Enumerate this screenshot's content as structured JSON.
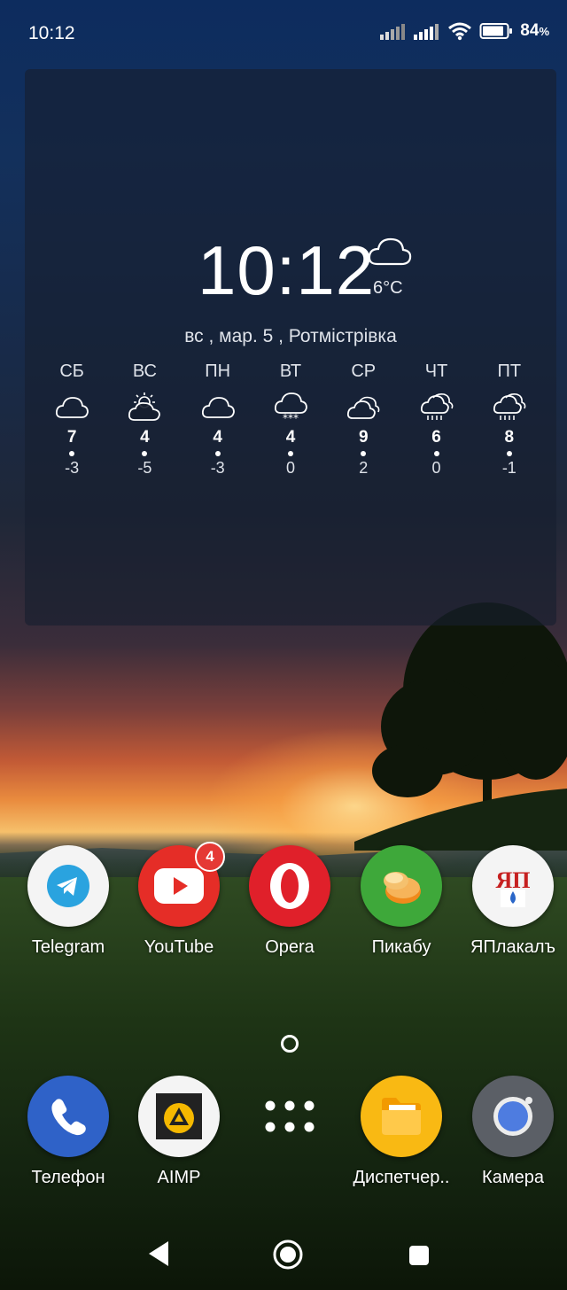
{
  "status_bar": {
    "time": "10:12",
    "battery_percent": "84",
    "battery_unit": "%",
    "icons": [
      "signal-1-icon",
      "signal-2-icon",
      "wifi-icon",
      "battery-icon"
    ]
  },
  "widget": {
    "clock": "10:12",
    "current_temp": "6°C",
    "current_icon": "cloud-icon",
    "date_line": "вс , мар. 5 ,  Ротмістрівка",
    "forecast": [
      {
        "day": "СБ",
        "icon": "cloud-icon",
        "high": "7",
        "low": "-3"
      },
      {
        "day": "ВС",
        "icon": "partly-sunny-icon",
        "high": "4",
        "low": "-5"
      },
      {
        "day": "ПН",
        "icon": "cloud-icon",
        "high": "4",
        "low": "-3"
      },
      {
        "day": "ВТ",
        "icon": "snow-cloud-icon",
        "high": "4",
        "low": "0"
      },
      {
        "day": "СР",
        "icon": "cloudy-icon",
        "high": "9",
        "low": "2"
      },
      {
        "day": "ЧТ",
        "icon": "rain-cloud-icon",
        "high": "6",
        "low": "0"
      },
      {
        "day": "ПТ",
        "icon": "rain-cloud-icon",
        "high": "8",
        "low": "-1"
      }
    ]
  },
  "apps_row": [
    {
      "label": "Telegram",
      "icon": "telegram-icon"
    },
    {
      "label": "YouTube",
      "icon": "youtube-icon",
      "badge": "4"
    },
    {
      "label": "Opera",
      "icon": "opera-icon"
    },
    {
      "label": "Пикабу",
      "icon": "pikabu-icon"
    },
    {
      "label": "ЯПлакалъ",
      "icon": "yaplakal-icon",
      "icon_text": "ЯП"
    }
  ],
  "dock": [
    {
      "label": "Телефон",
      "icon": "phone-icon"
    },
    {
      "label": "AIMP",
      "icon": "aimp-icon"
    },
    {
      "label": "",
      "icon": "app-drawer-icon"
    },
    {
      "label": "Диспетчер..",
      "icon": "folder-icon"
    },
    {
      "label": "Камера",
      "icon": "camera-icon"
    }
  ],
  "colors": {
    "badge": "#e53935",
    "telegram": "#2aa3df",
    "youtube": "#e52d27",
    "opera": "#e0202a",
    "pikabu": "#3ea83a",
    "phone": "#2f62c8",
    "aimp": "#f5b800",
    "folder": "#f9b913",
    "camera": "#4e7ce0"
  }
}
